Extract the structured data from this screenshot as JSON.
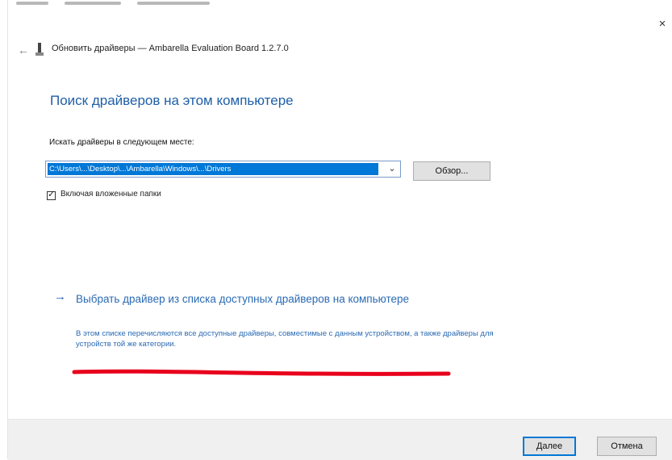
{
  "window": {
    "close_glyph": "×",
    "back_glyph": "←"
  },
  "header": {
    "breadcrumb": "Обновить драйверы — Ambarella Evaluation Board 1.2.7.0"
  },
  "main": {
    "title": "Поиск драйверов на этом компьютере",
    "search_label": "Искать драйверы в следующем месте:",
    "path_value": "C:\\Users\\...\\Desktop\\...\\Ambarella\\Windows\\...\\Drivers",
    "browse_label": "Обзор...",
    "include_subfolders_label": "Включая вложенные папки",
    "include_subfolders_checked": true,
    "pick_link_arrow": "→",
    "pick_link_title": "Выбрать драйвер из списка доступных драйверов на компьютере",
    "pick_link_desc": "В этом списке перечисляются все доступные драйверы, совместимые с данным устройством, а также драйверы для устройств той же категории."
  },
  "footer": {
    "next_label": "Далее",
    "cancel_label": "Отмена"
  },
  "colors": {
    "accent": "#0078d7",
    "link": "#2a6ab3",
    "annotation": "#e8001c"
  },
  "icons": [
    "back-arrow-icon",
    "device-icon",
    "close-icon",
    "dropdown-chevron-icon",
    "checkbox-check-icon",
    "link-arrow-icon"
  ]
}
